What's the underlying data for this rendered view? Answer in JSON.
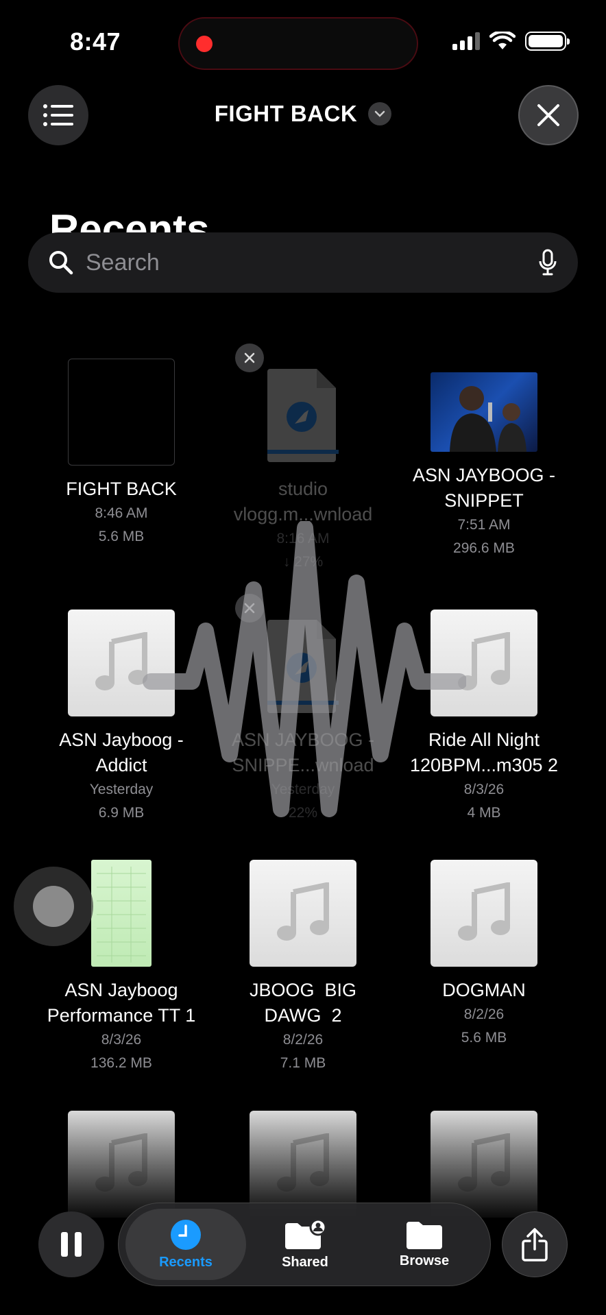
{
  "status": {
    "time": "8:47"
  },
  "header": {
    "title": "FIGHT BACK"
  },
  "page": {
    "heading": "Recents"
  },
  "search": {
    "placeholder": "Search"
  },
  "files": [
    {
      "name": "FIGHT BACK",
      "line1": "8:46 AM",
      "line2": "5.6 MB",
      "thumb": "black"
    },
    {
      "name": "studio vlogg.m...wnload",
      "line1": "8:16 AM",
      "line2": "↓ 27%",
      "thumb": "safari-download"
    },
    {
      "name": "ASN JAYBOOG - SNIPPET",
      "line1": "7:51 AM",
      "line2": "296.6 MB",
      "thumb": "video"
    },
    {
      "name": "ASN Jayboog - Addict",
      "line1": "Yesterday",
      "line2": "6.9 MB",
      "thumb": "music"
    },
    {
      "name": "ASN JAYBOOG - SNIPPE...wnload",
      "line1": "Yesterday",
      "line2": "22%",
      "thumb": "safari-download"
    },
    {
      "name": "Ride All Night 120BPM...m305 2",
      "line1": "8/3/26",
      "line2": "4 MB",
      "thumb": "music"
    },
    {
      "name": "ASN Jayboog Performance TT 1",
      "line1": "8/3/26",
      "line2": "136.2 MB",
      "thumb": "document"
    },
    {
      "name": "JBOOG  BIG DAWG  2",
      "line1": "8/2/26",
      "line2": "7.1 MB",
      "thumb": "music"
    },
    {
      "name": "DOGMAN",
      "line1": "8/2/26",
      "line2": "5.6 MB",
      "thumb": "music"
    }
  ],
  "tabs": [
    {
      "label": "Recents",
      "icon": "clock-icon",
      "active": true
    },
    {
      "label": "Shared",
      "icon": "shared-folder-icon"
    },
    {
      "label": "Browse",
      "icon": "folder-icon"
    }
  ],
  "colors": {
    "accent": "#1a9bff",
    "recording": "#ff2d2d",
    "background": "#000000"
  }
}
